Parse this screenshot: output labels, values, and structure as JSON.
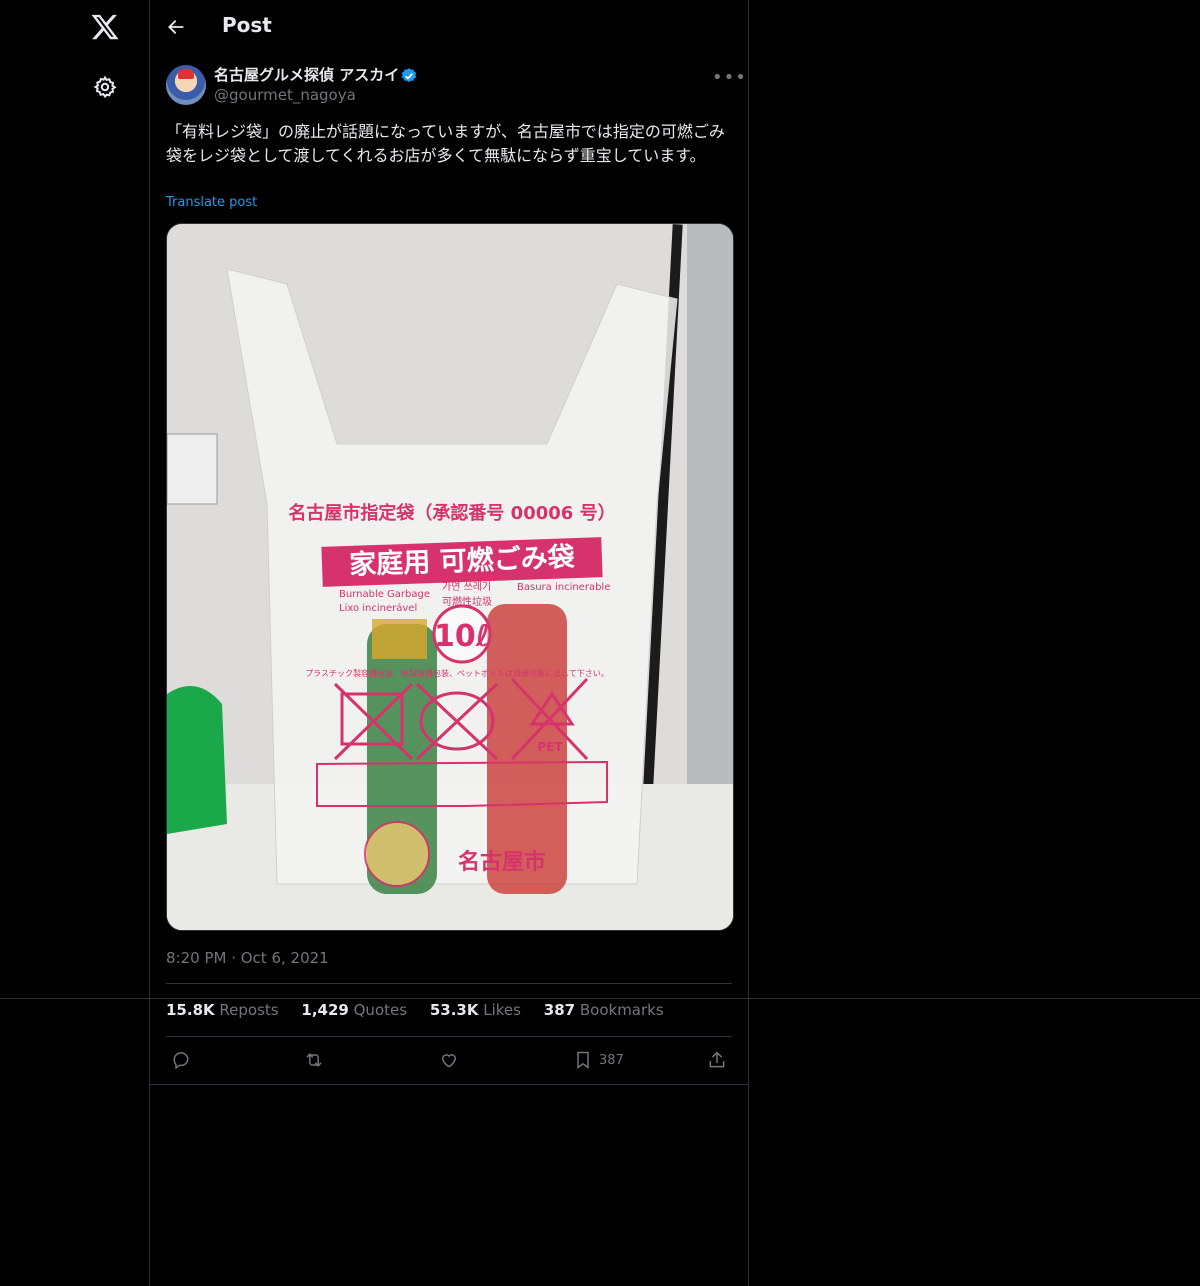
{
  "header": {
    "title": "Post"
  },
  "author": {
    "name": "名古屋グルメ探偵 アスカイ",
    "handle": "@gourmet_nagoya"
  },
  "post": {
    "text": "「有料レジ袋」の廃止が話題になっていますが、名古屋市では指定の可燃ごみ袋をレジ袋として渡してくれるお店が多くて無駄にならず重宝しています。",
    "translate_label": "Translate post",
    "timestamp": "8:20 PM · Oct 6, 2021"
  },
  "image": {
    "bag_header": "名古屋市指定袋（承認番号 00006 号）",
    "bag_title": "家庭用 可燃ごみ袋",
    "lang_1": "Burnable Garbage",
    "lang_2": "Lixo incinerável",
    "lang_3": "가연 쓰레기",
    "lang_4": "可燃性垃圾",
    "lang_5": "Basura incinerable",
    "capacity": "10ℓ",
    "warning": "プラスチック製容器包装、紙製容器包装、ペットボトルは資源収集に出して下さい。",
    "pet_label": "PET",
    "city_name": "名古屋市"
  },
  "stats": {
    "reposts_num": "15.8K",
    "reposts_label": "Reposts",
    "quotes_num": "1,429",
    "quotes_label": "Quotes",
    "likes_num": "53.3K",
    "likes_label": "Likes",
    "bookmarks_num": "387",
    "bookmarks_label": "Bookmarks"
  },
  "actions": {
    "bookmark_count": "387"
  },
  "colors": {
    "accent": "#1d9bf0",
    "muted": "#71767b",
    "text": "#e7e9ea",
    "bag_print": "#d6336c"
  }
}
